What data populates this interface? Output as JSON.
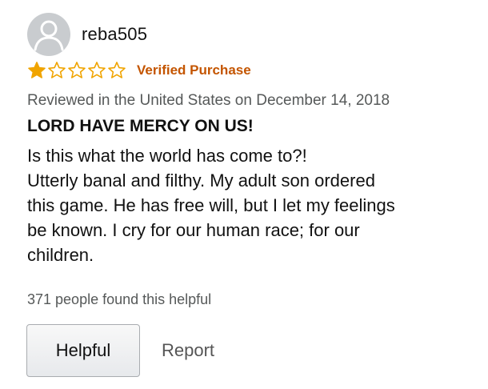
{
  "review": {
    "username": "reba505",
    "rating": 1,
    "max_rating": 5,
    "star_color": "#f0a400",
    "verified_label": "Verified Purchase",
    "verified_color": "#c45500",
    "reviewed_line": "Reviewed in the United States on December 14, 2018",
    "title": "LORD HAVE MERCY ON US!",
    "body_lines": [
      "Is this what the world has come to?!",
      "Utterly banal and filthy. My adult son ordered",
      "this game. He has free will, but I let my feelings",
      "be known. I cry for our human race; for our",
      "children."
    ],
    "helpful_count_text": "371 people found this helpful",
    "helpful_button_label": "Helpful",
    "report_label": "Report"
  },
  "icons": {
    "avatar": "user-silhouette-icon",
    "star_filled": "star-filled-icon",
    "star_empty": "star-outline-icon"
  }
}
